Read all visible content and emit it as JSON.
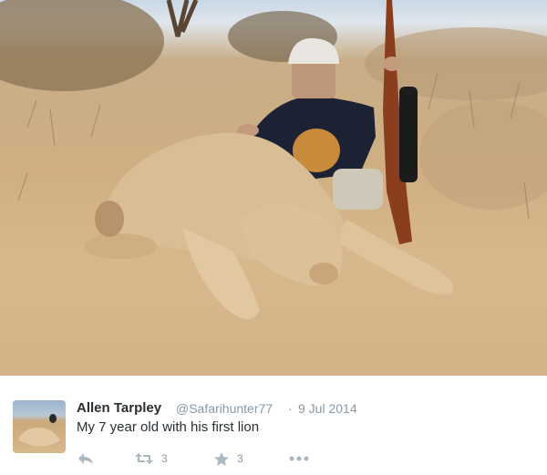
{
  "photo": {
    "subject": "photo-of-child-with-lion"
  },
  "tweet": {
    "author_name": "Allen Tarpley",
    "author_handle": "@Safarihunter77",
    "separator": "·",
    "date": "9 Jul 2014",
    "text": "My 7 year old with his first lion",
    "actions": {
      "reply_icon": "reply-icon",
      "retweet_icon": "retweet-icon",
      "retweet_count": "3",
      "favorite_icon": "star-icon",
      "favorite_count": "3",
      "more_icon": "more-icon"
    }
  },
  "colors": {
    "text_primary": "#292f33",
    "text_secondary": "#8899a6",
    "icon_gray": "#aab8c2"
  }
}
